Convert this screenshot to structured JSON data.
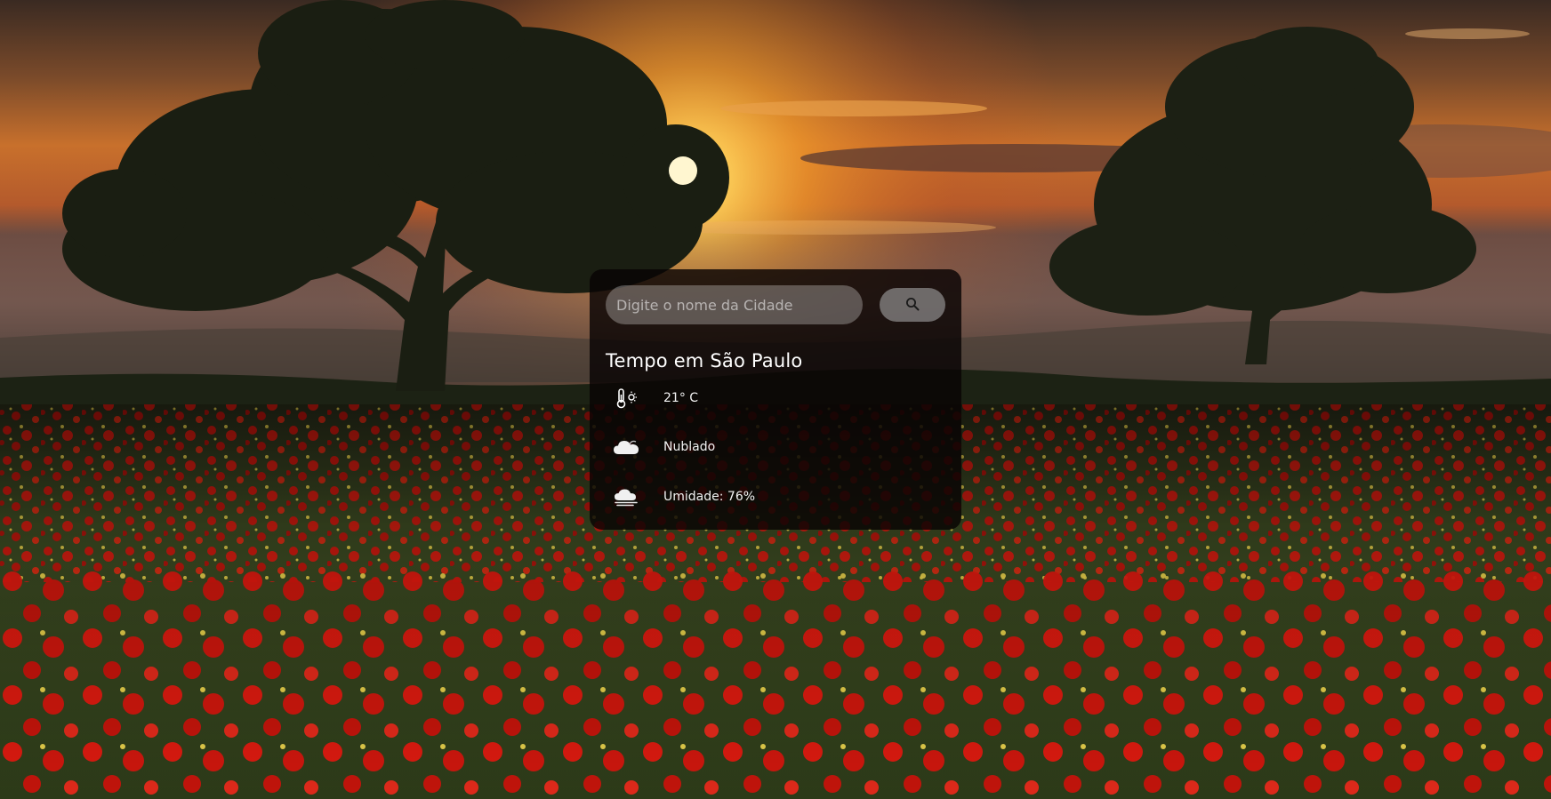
{
  "weather_card": {
    "search": {
      "placeholder": "Digite o nome da Cidade",
      "value": "",
      "button_icon": "search-icon"
    },
    "title": "Tempo em São Paulo",
    "items": [
      {
        "icon": "thermometer-sun-icon",
        "text": "21° C"
      },
      {
        "icon": "cloud-icon",
        "text": "Nublado"
      },
      {
        "icon": "humidity-cloud-icon",
        "text": "Umidade: 76%"
      }
    ]
  },
  "colors": {
    "card_background": "#080404",
    "text": "#ffffff",
    "input_background": "#6e6464",
    "button_background": "#a0a0a0",
    "sky_glow": "#f7a623",
    "poppy_red": "#d8140c"
  }
}
